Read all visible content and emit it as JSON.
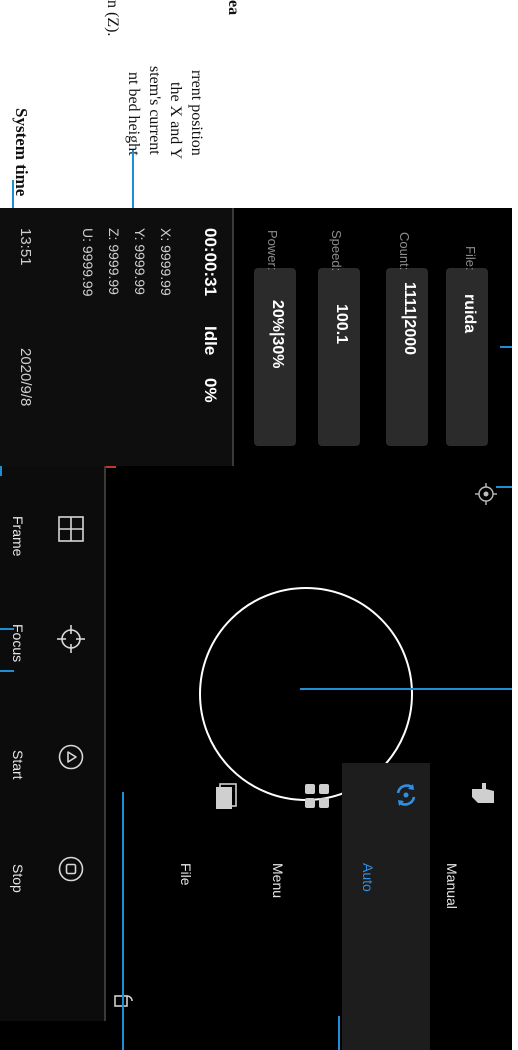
{
  "annotations": {
    "system_time_label": "System time",
    "partial_line_1": "ea",
    "partial_line_2": "rrent position",
    "partial_line_3": "the X and Y",
    "partial_line_4": "stem's current",
    "partial_line_5": "nt bed height",
    "partial_line_6": "n (Z)."
  },
  "file_panel": {
    "file_label": "File:",
    "file_value": "ruida",
    "count_label": "Count:",
    "count_value": "1111|2000",
    "speed_label": "Speed:",
    "speed_value": "100.1",
    "power_label": "Power:",
    "power_value": "20%|30%"
  },
  "status": {
    "elapsed": "00:00:31",
    "state": "Idle",
    "progress": "0%",
    "x": "X: 9999.99",
    "y": "Y: 9999.99",
    "z": "Z: 9999.99",
    "u": "U: 9999.99",
    "time": "13:51",
    "date": "2020/9/8"
  },
  "toolbar": {
    "frame": "Frame",
    "focus": "Focus",
    "start": "Start",
    "stop": "Stop"
  },
  "nav": {
    "manual": "Manual",
    "auto": "Auto",
    "menu": "Menu",
    "file": "File"
  },
  "colors": {
    "accent": "#1e8fd5",
    "screen_bg": "#000000",
    "field_bg": "#2b2b2b",
    "active_nav_text": "#2f8fe6"
  }
}
